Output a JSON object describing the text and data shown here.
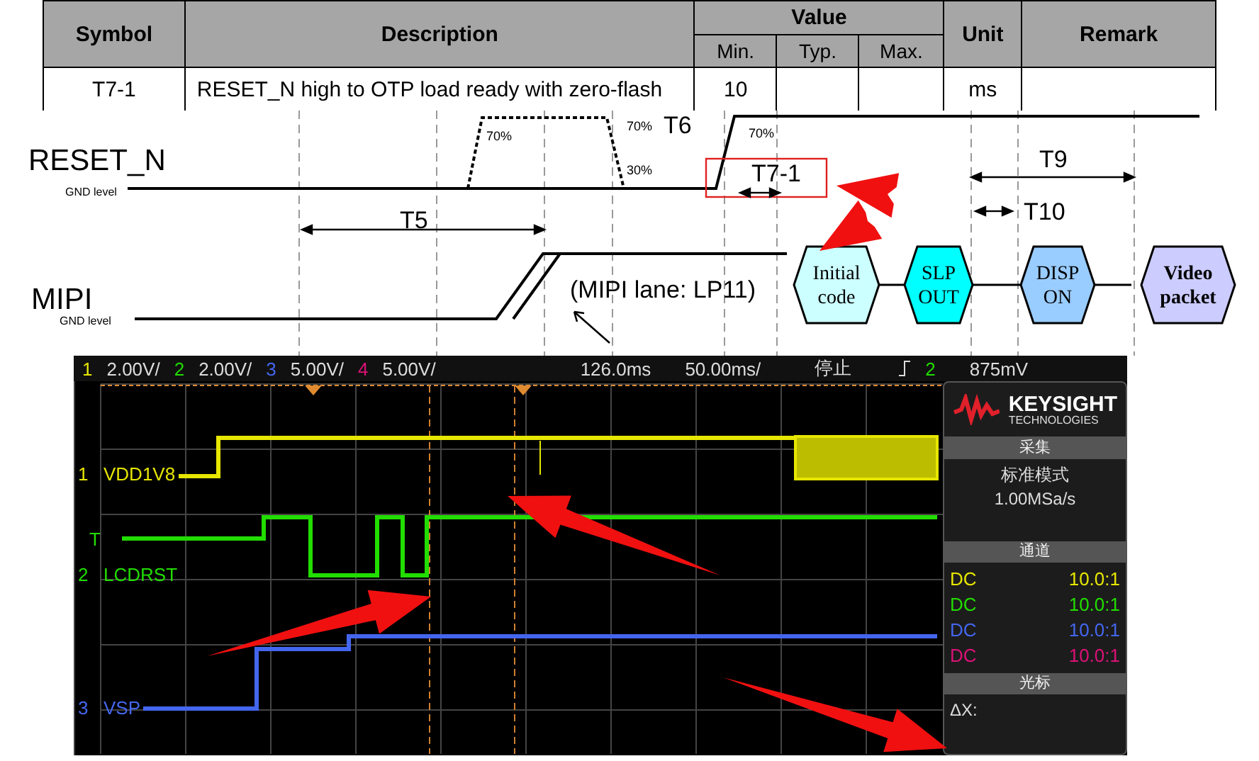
{
  "table": {
    "columns": [
      {
        "label": "Symbol"
      },
      {
        "label": "Description"
      },
      {
        "label": "Value",
        "subcolumns": [
          "Min.",
          "Typ.",
          "Max."
        ]
      },
      {
        "label": "Unit"
      },
      {
        "label": "Remark"
      }
    ],
    "rows": [
      {
        "symbol": "T7-1",
        "description": "RESET_N high to OTP load ready with zero-flash",
        "min": "10",
        "unit": "ms"
      }
    ]
  },
  "timing_diagram": {
    "signals": [
      {
        "name": "RESET_N",
        "ground": "GND level"
      },
      {
        "name": "MIPI",
        "ground": "GND level"
      }
    ],
    "thresholds": [
      "70%",
      "70%",
      "30%",
      "70%"
    ],
    "intervals": [
      {
        "label": "T5",
        "highlighted": false
      },
      {
        "label": "T6",
        "highlighted": false
      },
      {
        "label": "T7-1",
        "highlighted": true
      },
      {
        "label": "T9",
        "highlighted": false
      },
      {
        "label": "T10",
        "highlighted": false
      }
    ],
    "note": "(MIPI lane: LP11)",
    "packets": [
      {
        "lines": [
          "Initial",
          "code"
        ],
        "color": "#ccffff",
        "bold": false
      },
      {
        "lines": [
          "SLP",
          "OUT"
        ],
        "color": "#00ffff",
        "bold": false
      },
      {
        "lines": [
          "DISP",
          "ON"
        ],
        "color": "#99ccff",
        "bold": false
      },
      {
        "lines": [
          "Video",
          "packet"
        ],
        "color": "#ccccff",
        "bold": true
      }
    ]
  },
  "scope": {
    "top_bar": {
      "channels": [
        {
          "number": "1",
          "scale": "2.00V/",
          "color": "#e6e600"
        },
        {
          "number": "2",
          "scale": "2.00V/",
          "color": "#22dd00"
        },
        {
          "number": "3",
          "scale": "5.00V/",
          "color": "#4466ee"
        },
        {
          "number": "4",
          "scale": "5.00V/",
          "color": "#dd1177"
        }
      ],
      "delay": "126.0ms",
      "timebase": "50.00ms/",
      "status": "停止",
      "trigger_channel": "2",
      "trigger_level": "875mV"
    },
    "trigger_marker": "T",
    "traces": [
      {
        "number": "1",
        "label": "VDD1V8",
        "color": "#e6e600"
      },
      {
        "number": "2",
        "label": "LCDRST",
        "color": "#22dd00"
      },
      {
        "number": "3",
        "label": "VSP",
        "color": "#4466ee"
      }
    ],
    "panel": {
      "brand": "KEYSIGHT",
      "brand_sub": "TECHNOLOGIES",
      "sections": [
        {
          "title": "采集",
          "kind": "text",
          "lines": [
            "标准模式",
            "1.00MSa/s"
          ]
        },
        {
          "title": "通道",
          "kind": "channels",
          "rows": [
            {
              "coupling": "DC",
              "probe": "10.0:1",
              "color": "#e6e600"
            },
            {
              "coupling": "DC",
              "probe": "10.0:1",
              "color": "#22dd00"
            },
            {
              "coupling": "DC",
              "probe": "10.0:1",
              "color": "#4466ee"
            },
            {
              "coupling": "DC",
              "probe": "10.0:1",
              "color": "#dd1177"
            }
          ]
        },
        {
          "title": "光标",
          "kind": "text",
          "lines": [
            "ΔX:"
          ]
        }
      ]
    }
  }
}
